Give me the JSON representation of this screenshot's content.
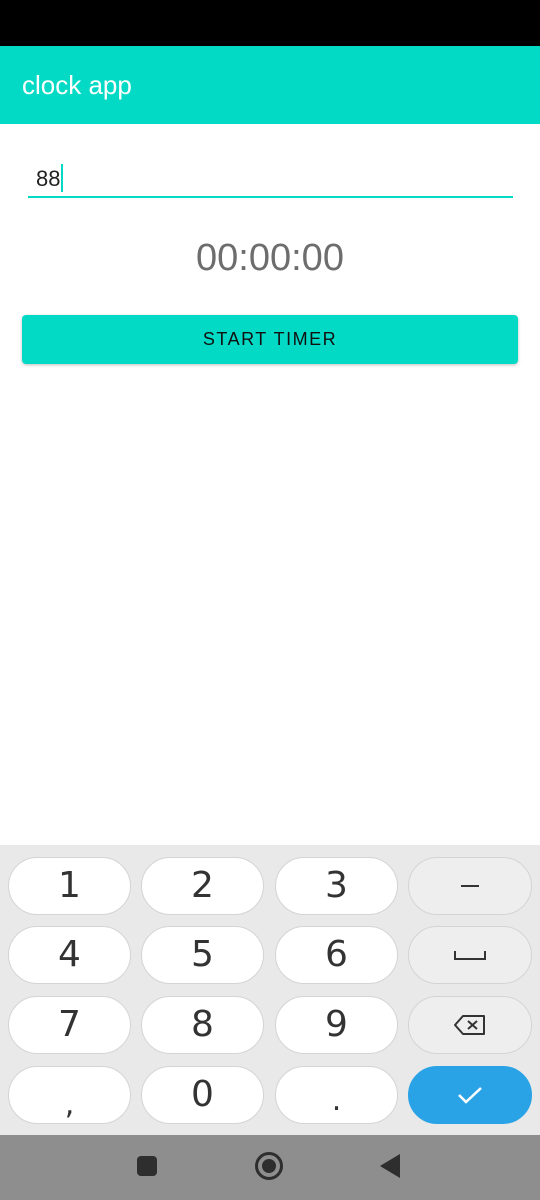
{
  "app_bar": {
    "title": "clock app"
  },
  "input": {
    "value": "88"
  },
  "timer": {
    "display": "00:00:00"
  },
  "start_button": {
    "label": "START TIMER"
  },
  "keyboard": {
    "keys": [
      "1",
      "2",
      "3",
      "4",
      "5",
      "6",
      "7",
      "8",
      "9",
      ",",
      "0",
      "."
    ],
    "func_keys": [
      "minus-icon",
      "space-icon",
      "backspace-icon",
      "check-icon"
    ]
  },
  "colors": {
    "accent": "#03dac5",
    "done_key": "#2aa3e6"
  }
}
